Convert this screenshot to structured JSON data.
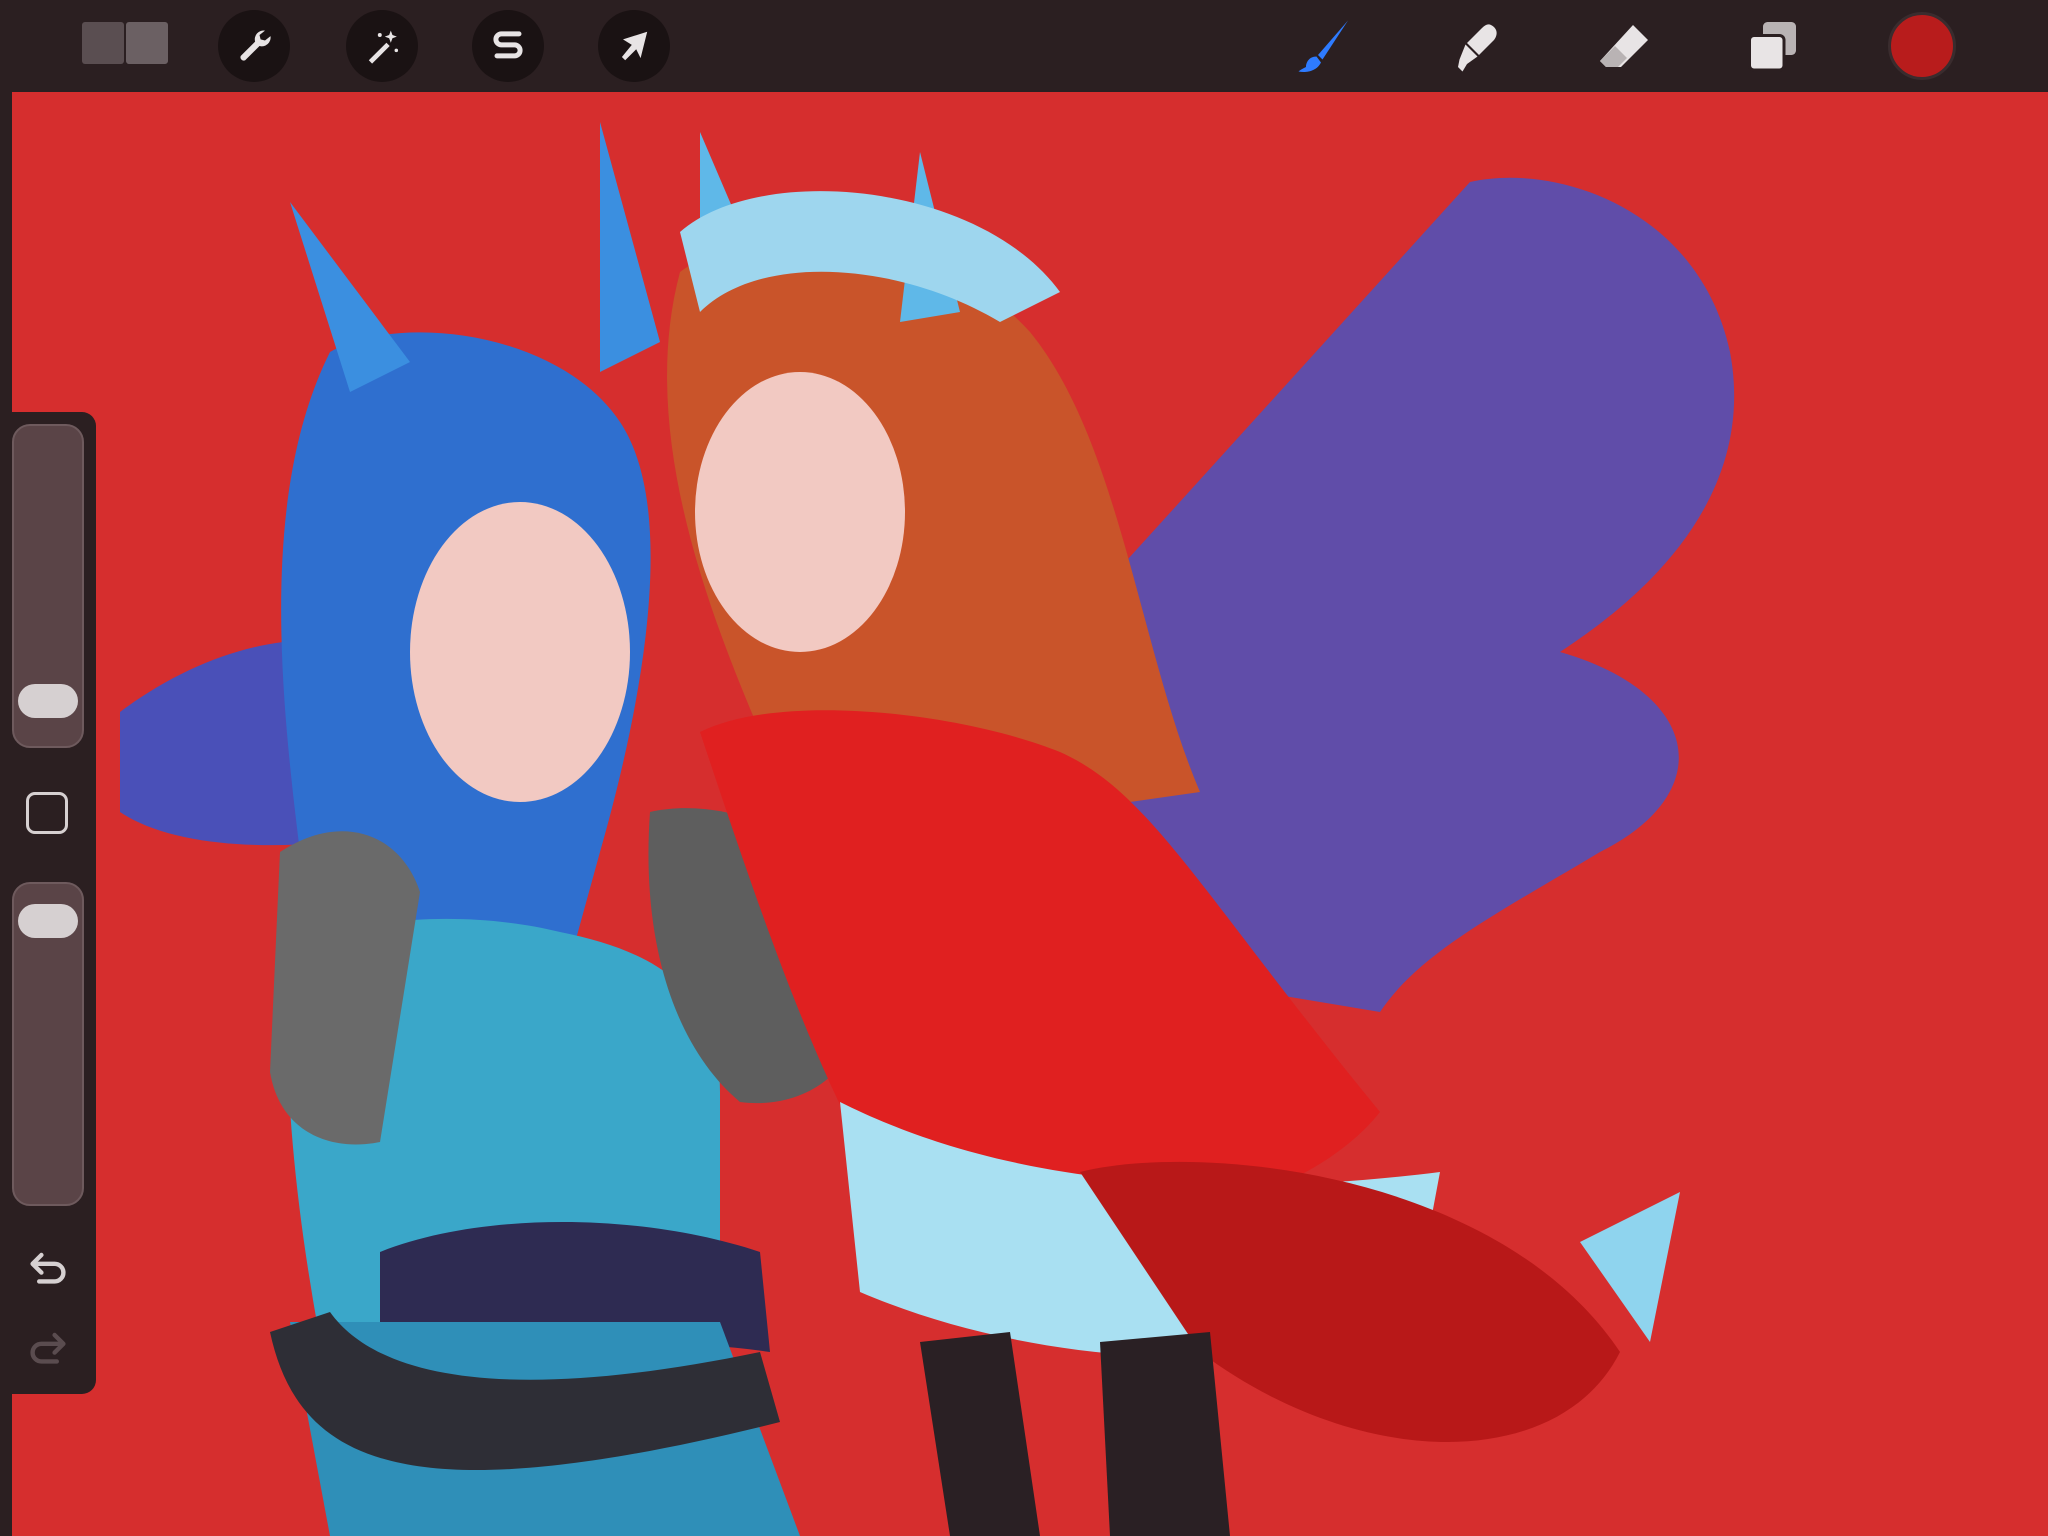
{
  "app": {
    "colors": {
      "toolbar_bg": "#2b1f21",
      "canvas_bg": "#d62e2e",
      "active_tool": "#2e7bff",
      "current_color": "#b81c1c",
      "icon_color": "#e8e4e5"
    }
  },
  "toolbar": {
    "left_tools": [
      {
        "name": "gallery",
        "icon": "gallery-icon"
      },
      {
        "name": "actions",
        "icon": "wrench-icon"
      },
      {
        "name": "adjustments",
        "icon": "magic-wand-icon"
      },
      {
        "name": "selection",
        "icon": "selection-s-icon"
      },
      {
        "name": "transform",
        "icon": "arrow-cursor-icon"
      }
    ],
    "right_tools": [
      {
        "name": "brush",
        "icon": "brush-icon",
        "active": true
      },
      {
        "name": "smudge",
        "icon": "smudge-icon",
        "active": false
      },
      {
        "name": "eraser",
        "icon": "eraser-icon",
        "active": false
      },
      {
        "name": "layers",
        "icon": "layers-icon",
        "active": false
      },
      {
        "name": "color",
        "icon": "color-swatch",
        "active": false
      }
    ]
  },
  "sidebar": {
    "brush_size": 0.08,
    "brush_opacity": 0.95,
    "modify_icon": "square-icon",
    "undo_icon": "undo-icon",
    "redo_icon": "redo-icon",
    "redo_enabled": false
  }
}
